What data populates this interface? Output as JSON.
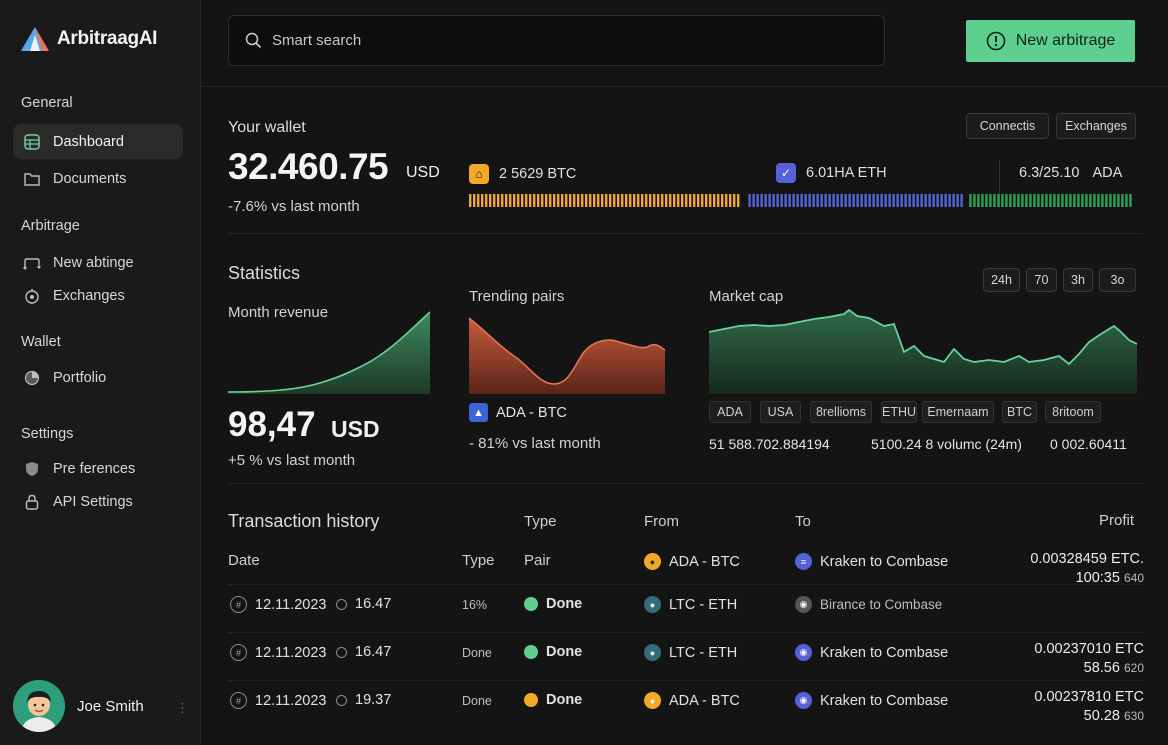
{
  "app": {
    "name": "ArbitraagAI"
  },
  "colors": {
    "accent": "#5fcf8f",
    "btc": "#f0a92a",
    "eth": "#5561d6",
    "ada": "#2ea15a",
    "danger": "#e26a4a"
  },
  "sidebar": {
    "general_label": "General",
    "arbitrage_label": "Arbitrage",
    "wallet_label": "Wallet",
    "settings_label": "Settings",
    "items": [
      {
        "label": "Dashboard",
        "icon": "grid-icon"
      },
      {
        "label": "Documents",
        "icon": "folder-icon"
      },
      {
        "label": "New abtinge",
        "icon": "route-icon"
      },
      {
        "label": "Exchanges",
        "icon": "exchange-icon"
      },
      {
        "label": "Portfolio",
        "icon": "pie-icon"
      },
      {
        "label": "Pre ferences",
        "icon": "shield-icon"
      },
      {
        "label": "API Settings",
        "icon": "lock-icon"
      }
    ],
    "user": {
      "name": "Joe Smith"
    }
  },
  "topbar": {
    "search_placeholder": "Smart search",
    "new_button": "New arbitrage"
  },
  "wallet": {
    "label": "Your wallet",
    "amount": "32.460.75",
    "currency": "USD",
    "change": "-7.6% vs last month",
    "tab1": "Connectis",
    "tab2": "Exchanges",
    "coins": [
      {
        "label": "2 5629 BTC",
        "share": 0.42
      },
      {
        "label": "6.01HA ETH",
        "share": 0.33
      },
      {
        "label": "6.3/25.10",
        "suffix": "ADA",
        "share": 0.25
      }
    ]
  },
  "statistics": {
    "title": "Statistics",
    "revenue": {
      "label": "Month revenue",
      "value": "98,47",
      "currency": "USD",
      "change": "+5 % vs last month"
    },
    "trending": {
      "label": "Trending pairs",
      "pair": "ADA - BTC",
      "change": "- 81% vs last month"
    },
    "market": {
      "label": "Market cap",
      "ranges": [
        "24h",
        "70",
        "3h",
        "3o"
      ],
      "tags": [
        "ADA",
        "USA",
        "8rellioms",
        "ETHU",
        "Emernaam",
        "BTC",
        "8ritoom"
      ],
      "values": [
        "51 588.702.884194",
        "5100.24 8 volumc (24m)",
        "0 002.60411"
      ]
    }
  },
  "transactions": {
    "title": "Transaction history",
    "head_type": "Type",
    "head_from": "From",
    "head_to": "To",
    "head_profit": "Profit",
    "sub_date": "Date",
    "sub_type": "Type",
    "sub_pair": "Pair",
    "top_row": {
      "from": "ADA - BTC",
      "to": "Kraken to Combase",
      "profit": "0.00328459 ETC.",
      "profit2": "100:35",
      "profit2_small": "640"
    },
    "rows": [
      {
        "date": "12.11.2023",
        "time": "16.47",
        "type": "16%",
        "status": "Done",
        "status_color": "#5fcf8f",
        "from": "LTC - ETH",
        "to": "Birance to Combase",
        "profit": "",
        "profit2": "",
        "profit2_small": ""
      },
      {
        "date": "12.11.2023",
        "time": "16.47",
        "type": "Done",
        "status": "Done",
        "status_color": "#5fcf8f",
        "from": "LTC - ETH",
        "to": "Kraken to Combase",
        "profit": "0.00237010 ETC",
        "profit2": "58.56",
        "profit2_small": "620"
      },
      {
        "date": "12.11.2023",
        "time": "19.37",
        "type": "Done",
        "status": "Done",
        "status_color": "#f0a92a",
        "from": "ADA - BTC",
        "to": "Kraken to Combase",
        "profit": "0.00237810 ETC",
        "profit2": "50.28",
        "profit2_small": "630"
      }
    ]
  }
}
